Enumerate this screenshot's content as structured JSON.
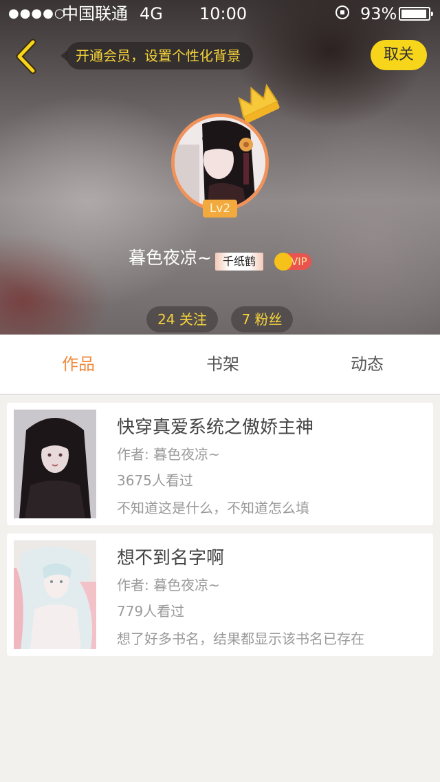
{
  "status_bar": {
    "signal_dots": "●●●●○",
    "carrier": "中国联通",
    "network": "4G",
    "time": "10:00",
    "battery_percent": "93%"
  },
  "header": {
    "back_icon": "chevron-left-icon",
    "vip_banner": "开通会员，设置个性化背景",
    "cancel_label": "取关"
  },
  "profile": {
    "level": "Lv2",
    "username": "暮色夜凉~",
    "tag": "千纸鹤",
    "vip_label": "VIP",
    "follow_count_label": "24 关注",
    "fans_count_label": "7 粉丝",
    "colors": {
      "accent": "#f08a3c",
      "cancel_bg": "#f7d51a",
      "banner_text": "#f7d43a",
      "vip_red": "#e9544f"
    }
  },
  "tabs": [
    {
      "label": "作品",
      "active": true
    },
    {
      "label": "书架",
      "active": false
    },
    {
      "label": "动态",
      "active": false
    }
  ],
  "books": [
    {
      "title": "快穿真爱系统之傲娇主神",
      "author": "作者: 暮色夜凉~",
      "views": "3675人看过",
      "description": "不知道这是什么，不知道怎么填"
    },
    {
      "title": "想不到名字啊",
      "author": "作者: 暮色夜凉~",
      "views": "779人看过",
      "description": "想了好多书名，结果都显示该书名已存在"
    }
  ]
}
